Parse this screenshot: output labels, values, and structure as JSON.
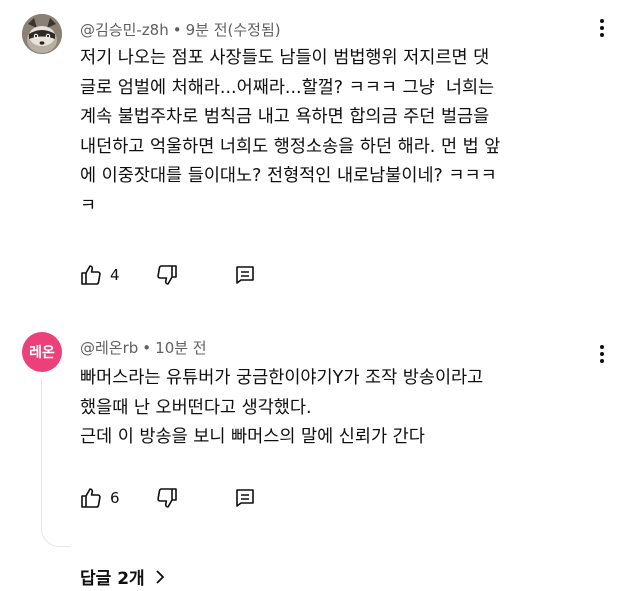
{
  "comments": [
    {
      "author": "@김승민-z8h",
      "time": "9분 전(수정됨)",
      "text": "저기 나오는 점포 사장들도 남들이 범법행위 저지르면 댓\n글로 엄벌에 처해라...어째라...할껄? ㅋㅋㅋ 그냥  너희는\n계속 불법주차로 범칙금 내고 욕하면 합의금 주던 벌금을\n내던하고 억울하면 너희도 행정소송을 하던 해라. 먼 법 앞\n에 이중잣대를 들이대노? 전형적인 내로남불이네? ㅋㅋㅋ\nㅋ",
      "likes": "4",
      "avatar_icon": "raccoon-avatar-icon"
    },
    {
      "author": "@레온rb",
      "time": "10분 전",
      "avatar_letter": "레온",
      "text": "빠머스라는 유튜버가 궁금한이야기Y가 조작 방송이라고\n했을때 난 오버떤다고 생각했다.\n근데 이 방송을 보니 빠머스의 말에 신뢰가 간다",
      "likes": "6",
      "avatar_color": "#ec407a"
    }
  ],
  "replies_label": "답글 2개"
}
